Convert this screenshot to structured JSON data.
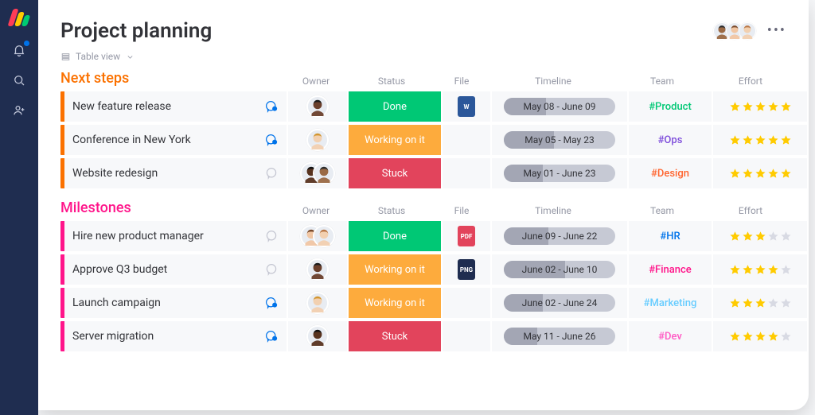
{
  "page": {
    "title": "Project planning"
  },
  "view": {
    "label": "Table view"
  },
  "columns": {
    "owner": "Owner",
    "status": "Status",
    "file": "File",
    "timeline": "Timeline",
    "team": "Team",
    "effort": "Effort"
  },
  "groups": [
    {
      "id": "next",
      "title": "Next steps",
      "accent": "orange",
      "rows": [
        {
          "task": "New feature release",
          "chat": "active",
          "owners": 1,
          "status": {
            "label": "Done",
            "class": "done"
          },
          "file": {
            "label": "W",
            "class": "w"
          },
          "timeline": {
            "label": "May 08 - June 09",
            "progress": 38
          },
          "team": {
            "label": "#Product",
            "class": "product"
          },
          "effort": 5
        },
        {
          "task": "Conference in New York",
          "chat": "active",
          "owners": 1,
          "status": {
            "label": "Working on it",
            "class": "working"
          },
          "file": null,
          "timeline": {
            "label": "May 05 - May 23",
            "progress": 45
          },
          "team": {
            "label": "#Ops",
            "class": "ops"
          },
          "effort": 5
        },
        {
          "task": "Website redesign",
          "chat": "empty",
          "owners": 2,
          "status": {
            "label": "Stuck",
            "class": "stuck"
          },
          "file": null,
          "timeline": {
            "label": "May 01 - June 23",
            "progress": 35
          },
          "team": {
            "label": "#Design",
            "class": "design"
          },
          "effort": 5
        }
      ]
    },
    {
      "id": "milestones",
      "title": "Milestones",
      "accent": "pink",
      "rows": [
        {
          "task": "Hire new product manager",
          "chat": "empty",
          "owners": 2,
          "status": {
            "label": "Done",
            "class": "done"
          },
          "file": {
            "label": "PDF",
            "class": "pdf"
          },
          "timeline": {
            "label": "June 09 - June 22",
            "progress": 40
          },
          "team": {
            "label": "#HR",
            "class": "hr"
          },
          "effort": 3
        },
        {
          "task": "Approve Q3 budget",
          "chat": "empty",
          "owners": 1,
          "status": {
            "label": "Working on it",
            "class": "working"
          },
          "file": {
            "label": "PNG",
            "class": "png"
          },
          "timeline": {
            "label": "June 02 - June 10",
            "progress": 55
          },
          "team": {
            "label": "#Finance",
            "class": "finance"
          },
          "effort": 4
        },
        {
          "task": "Launch campaign",
          "chat": "active",
          "owners": 1,
          "status": {
            "label": "Working on it",
            "class": "working"
          },
          "file": null,
          "timeline": {
            "label": "June 02 - June 24",
            "progress": 35
          },
          "team": {
            "label": "#Marketing",
            "class": "marketing"
          },
          "effort": 3
        },
        {
          "task": "Server migration",
          "chat": "active",
          "owners": 1,
          "status": {
            "label": "Stuck",
            "class": "stuck"
          },
          "file": null,
          "timeline": {
            "label": "May 11 - June 26",
            "progress": 30
          },
          "team": {
            "label": "#Dev",
            "class": "dev"
          },
          "effort": 4
        }
      ]
    }
  ],
  "avatar_palette": [
    {
      "skin": "#9b6a45",
      "hair": "#2b2b2b"
    },
    {
      "skin": "#f1c6a3",
      "hair": "#7a4a2b"
    },
    {
      "skin": "#f2d0b0",
      "hair": "#b97745"
    },
    {
      "skin": "#6a3f2b",
      "hair": "#1a1a1a"
    },
    {
      "skin": "#f2d0b0",
      "hair": "#d2952f"
    },
    {
      "skin": "#58331f",
      "hair": "#111"
    }
  ]
}
